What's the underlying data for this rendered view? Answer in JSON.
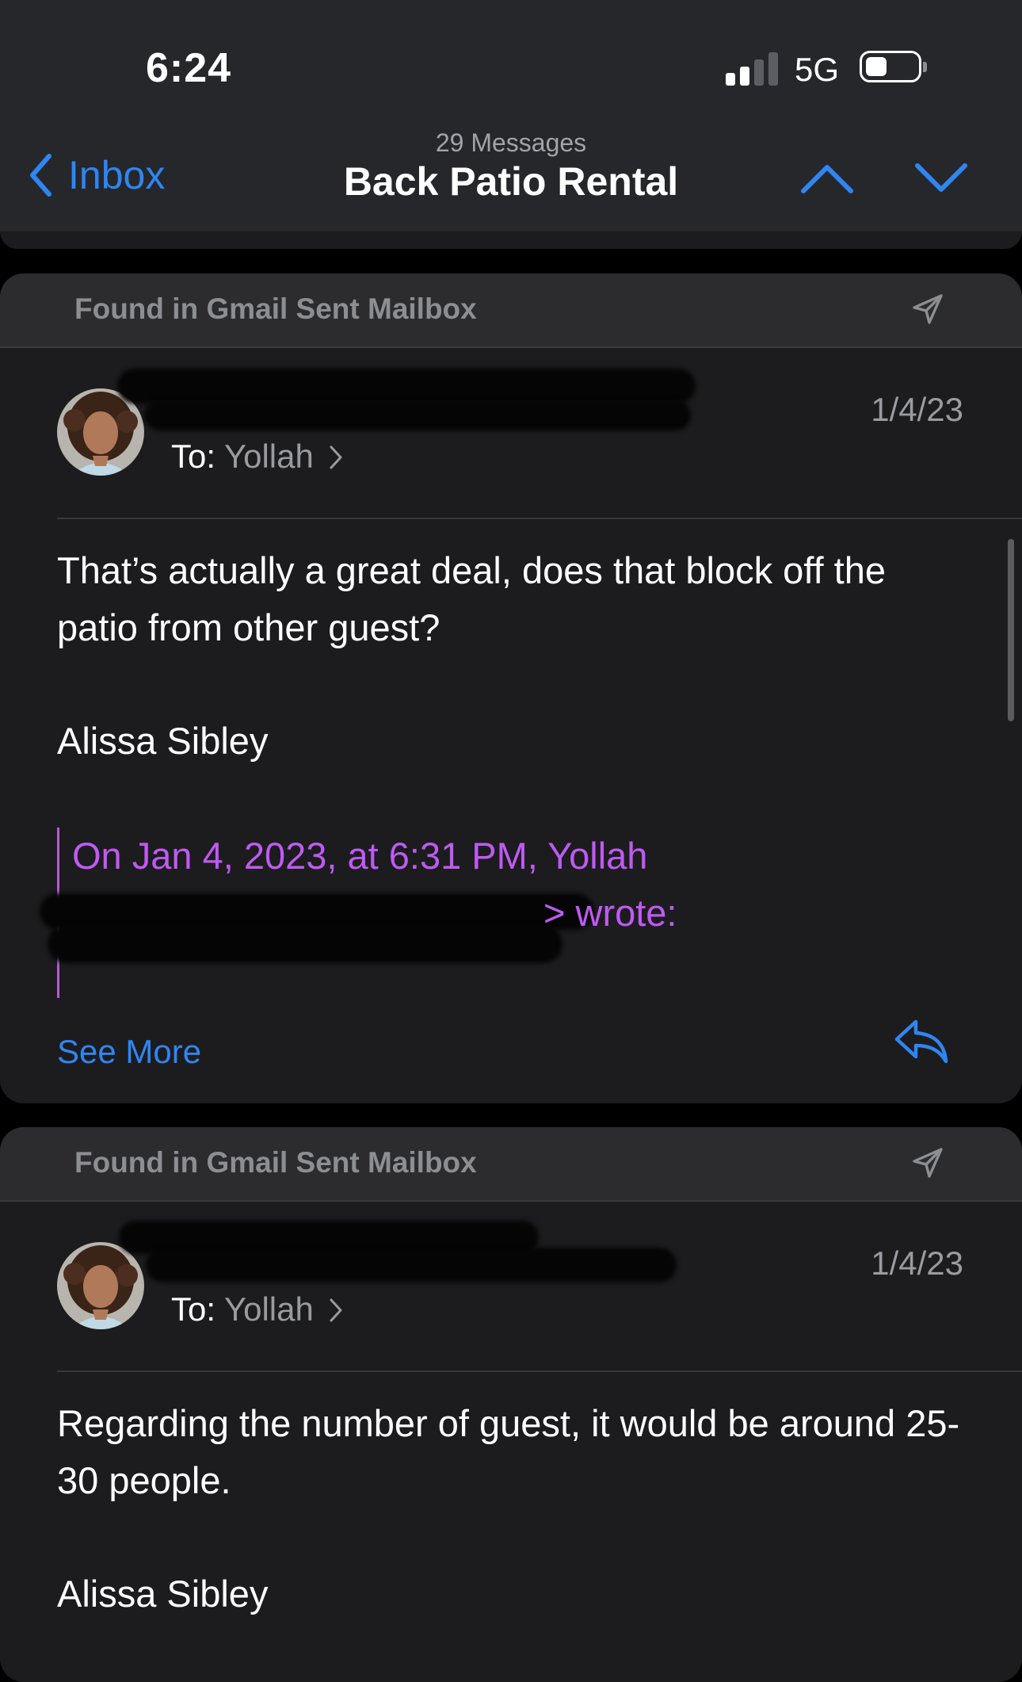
{
  "status_bar": {
    "time": "6:24",
    "network": "5G"
  },
  "nav": {
    "back_label": "Inbox",
    "message_count": "29 Messages",
    "title": "Back Patio Rental"
  },
  "messages": [
    {
      "found_in": "Found in Gmail Sent Mailbox",
      "to_label": "To:",
      "to_name": "Yollah",
      "date": "1/4/23",
      "body": "That’s actually a great deal, does that block off the patio from other guest?",
      "signature": "Alissa Sibley",
      "quote_line1": "On Jan 4, 2023, at 6:31 PM, Yollah",
      "quote_line2": "> wrote:",
      "see_more": "See More"
    },
    {
      "found_in": "Found in Gmail Sent Mailbox",
      "to_label": "To:",
      "to_name": "Yollah",
      "date": "1/4/23",
      "body": "Regarding the number of guest, it would be around 25-30 people.",
      "signature": "Alissa Sibley"
    }
  ],
  "colors": {
    "accent": "#2f86f2",
    "quote": "#bf5af2",
    "card_bg": "#1c1c1e",
    "header_bg": "#2c2c2e"
  },
  "icons": [
    "chevron-left-icon",
    "chevron-up-icon",
    "chevron-down-icon",
    "sent-icon",
    "reply-icon"
  ]
}
